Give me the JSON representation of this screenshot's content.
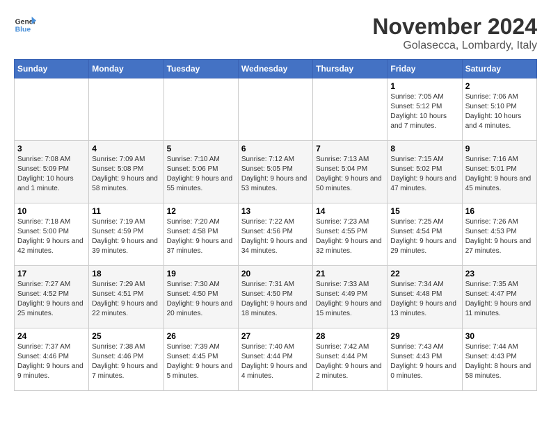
{
  "logo": {
    "text_general": "General",
    "text_blue": "Blue"
  },
  "header": {
    "month": "November 2024",
    "location": "Golasecca, Lombardy, Italy"
  },
  "weekdays": [
    "Sunday",
    "Monday",
    "Tuesday",
    "Wednesday",
    "Thursday",
    "Friday",
    "Saturday"
  ],
  "weeks": [
    [
      {
        "day": "",
        "info": ""
      },
      {
        "day": "",
        "info": ""
      },
      {
        "day": "",
        "info": ""
      },
      {
        "day": "",
        "info": ""
      },
      {
        "day": "",
        "info": ""
      },
      {
        "day": "1",
        "info": "Sunrise: 7:05 AM\nSunset: 5:12 PM\nDaylight: 10 hours and 7 minutes."
      },
      {
        "day": "2",
        "info": "Sunrise: 7:06 AM\nSunset: 5:10 PM\nDaylight: 10 hours and 4 minutes."
      }
    ],
    [
      {
        "day": "3",
        "info": "Sunrise: 7:08 AM\nSunset: 5:09 PM\nDaylight: 10 hours and 1 minute."
      },
      {
        "day": "4",
        "info": "Sunrise: 7:09 AM\nSunset: 5:08 PM\nDaylight: 9 hours and 58 minutes."
      },
      {
        "day": "5",
        "info": "Sunrise: 7:10 AM\nSunset: 5:06 PM\nDaylight: 9 hours and 55 minutes."
      },
      {
        "day": "6",
        "info": "Sunrise: 7:12 AM\nSunset: 5:05 PM\nDaylight: 9 hours and 53 minutes."
      },
      {
        "day": "7",
        "info": "Sunrise: 7:13 AM\nSunset: 5:04 PM\nDaylight: 9 hours and 50 minutes."
      },
      {
        "day": "8",
        "info": "Sunrise: 7:15 AM\nSunset: 5:02 PM\nDaylight: 9 hours and 47 minutes."
      },
      {
        "day": "9",
        "info": "Sunrise: 7:16 AM\nSunset: 5:01 PM\nDaylight: 9 hours and 45 minutes."
      }
    ],
    [
      {
        "day": "10",
        "info": "Sunrise: 7:18 AM\nSunset: 5:00 PM\nDaylight: 9 hours and 42 minutes."
      },
      {
        "day": "11",
        "info": "Sunrise: 7:19 AM\nSunset: 4:59 PM\nDaylight: 9 hours and 39 minutes."
      },
      {
        "day": "12",
        "info": "Sunrise: 7:20 AM\nSunset: 4:58 PM\nDaylight: 9 hours and 37 minutes."
      },
      {
        "day": "13",
        "info": "Sunrise: 7:22 AM\nSunset: 4:56 PM\nDaylight: 9 hours and 34 minutes."
      },
      {
        "day": "14",
        "info": "Sunrise: 7:23 AM\nSunset: 4:55 PM\nDaylight: 9 hours and 32 minutes."
      },
      {
        "day": "15",
        "info": "Sunrise: 7:25 AM\nSunset: 4:54 PM\nDaylight: 9 hours and 29 minutes."
      },
      {
        "day": "16",
        "info": "Sunrise: 7:26 AM\nSunset: 4:53 PM\nDaylight: 9 hours and 27 minutes."
      }
    ],
    [
      {
        "day": "17",
        "info": "Sunrise: 7:27 AM\nSunset: 4:52 PM\nDaylight: 9 hours and 25 minutes."
      },
      {
        "day": "18",
        "info": "Sunrise: 7:29 AM\nSunset: 4:51 PM\nDaylight: 9 hours and 22 minutes."
      },
      {
        "day": "19",
        "info": "Sunrise: 7:30 AM\nSunset: 4:50 PM\nDaylight: 9 hours and 20 minutes."
      },
      {
        "day": "20",
        "info": "Sunrise: 7:31 AM\nSunset: 4:50 PM\nDaylight: 9 hours and 18 minutes."
      },
      {
        "day": "21",
        "info": "Sunrise: 7:33 AM\nSunset: 4:49 PM\nDaylight: 9 hours and 15 minutes."
      },
      {
        "day": "22",
        "info": "Sunrise: 7:34 AM\nSunset: 4:48 PM\nDaylight: 9 hours and 13 minutes."
      },
      {
        "day": "23",
        "info": "Sunrise: 7:35 AM\nSunset: 4:47 PM\nDaylight: 9 hours and 11 minutes."
      }
    ],
    [
      {
        "day": "24",
        "info": "Sunrise: 7:37 AM\nSunset: 4:46 PM\nDaylight: 9 hours and 9 minutes."
      },
      {
        "day": "25",
        "info": "Sunrise: 7:38 AM\nSunset: 4:46 PM\nDaylight: 9 hours and 7 minutes."
      },
      {
        "day": "26",
        "info": "Sunrise: 7:39 AM\nSunset: 4:45 PM\nDaylight: 9 hours and 5 minutes."
      },
      {
        "day": "27",
        "info": "Sunrise: 7:40 AM\nSunset: 4:44 PM\nDaylight: 9 hours and 4 minutes."
      },
      {
        "day": "28",
        "info": "Sunrise: 7:42 AM\nSunset: 4:44 PM\nDaylight: 9 hours and 2 minutes."
      },
      {
        "day": "29",
        "info": "Sunrise: 7:43 AM\nSunset: 4:43 PM\nDaylight: 9 hours and 0 minutes."
      },
      {
        "day": "30",
        "info": "Sunrise: 7:44 AM\nSunset: 4:43 PM\nDaylight: 8 hours and 58 minutes."
      }
    ]
  ]
}
